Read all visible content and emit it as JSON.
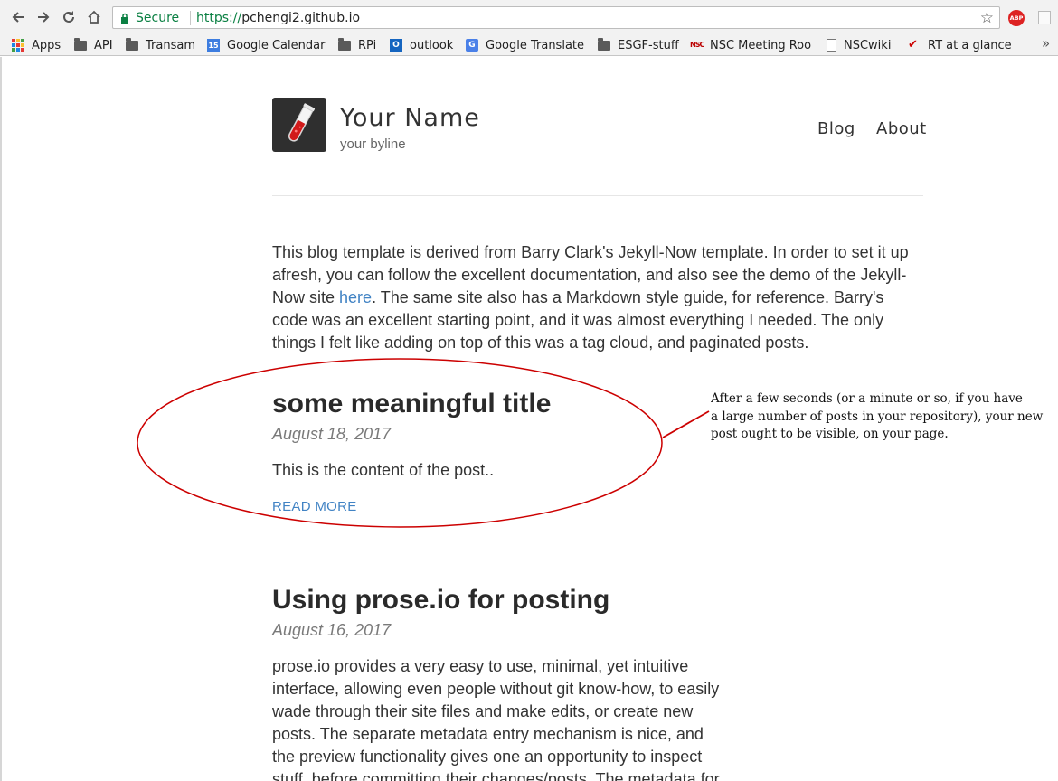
{
  "browser": {
    "secure_label": "Secure",
    "url_scheme": "https://",
    "url_host": "pchengi2.github.io",
    "extension_abp": "ABP",
    "bookmark_overflow": "»",
    "bookmarks": [
      {
        "label": "Apps",
        "icon": "apps-grid-icon"
      },
      {
        "label": "API",
        "icon": "folder-icon"
      },
      {
        "label": "Transam",
        "icon": "folder-icon"
      },
      {
        "label": "Google Calendar",
        "icon": "calendar-icon",
        "badge": "15"
      },
      {
        "label": "RPi",
        "icon": "folder-icon"
      },
      {
        "label": "outlook",
        "icon": "outlook-icon",
        "badge": "O"
      },
      {
        "label": "Google Translate",
        "icon": "translate-icon",
        "badge": "G"
      },
      {
        "label": "ESGF-stuff",
        "icon": "folder-icon"
      },
      {
        "label": "NSC Meeting Roo",
        "icon": "nsc-icon",
        "badge": "NSC"
      },
      {
        "label": "NSCwiki",
        "icon": "document-icon"
      },
      {
        "label": "RT at a glance",
        "icon": "checkmark-icon",
        "badge": "✔"
      }
    ]
  },
  "site": {
    "name": "Your Name",
    "byline": "your byline",
    "nav": [
      "Blog",
      "About"
    ]
  },
  "intro": {
    "before_link": "This blog template is derived from Barry Clark's Jekyll-Now template. In order to set it up afresh, you can follow the excellent documentation, and also see the demo of the Jekyll-Now site ",
    "link_text": "here",
    "after_link": ". The same site also has a Markdown style guide, for reference. Barry's code was an excellent starting point, and it was almost everything I needed. The only things I felt like adding on top of this was a tag cloud, and paginated posts."
  },
  "posts": [
    {
      "title": "some meaningful title",
      "date": "August 18, 2017",
      "excerpt": "This is the content of the post..",
      "read_more": "READ MORE"
    },
    {
      "title": "Using prose.io for posting",
      "date": "August 16, 2017",
      "excerpt_lines": [
        "prose.io provides a very easy to use, minimal, yet intuitive",
        "interface, allowing even people without git know-how, to easily",
        "wade through their site files and make edits, or create new",
        "posts. The separate metadata entry mechanism is nice, and",
        "the preview functionality gives one an opportunity to inspect",
        "stuff, before committing their changes/posts. The metadata for"
      ]
    }
  ],
  "annotation": {
    "lines": [
      "After a few seconds (or a minute or so, if you have",
      "a large number of posts in your repository), your new",
      "post ought to be visible, on your page."
    ],
    "color": "#cc0000"
  }
}
